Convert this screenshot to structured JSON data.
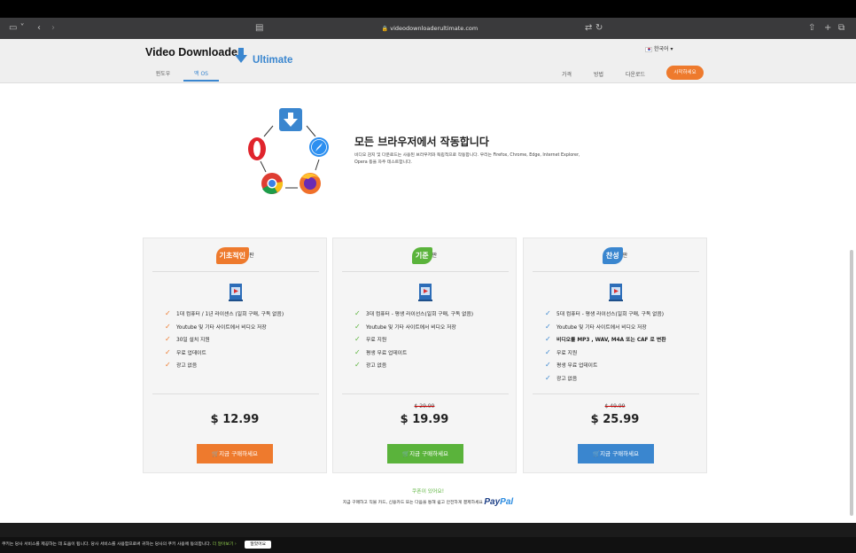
{
  "browser": {
    "url": "videodownloaderultimate.com"
  },
  "header": {
    "logo_main": "Video Downloader",
    "logo_sub": "Ultimate",
    "language": "한국어 ▾",
    "tabs": [
      {
        "label": "윈도우",
        "active": false
      },
      {
        "label": "맥 OS",
        "active": true
      }
    ],
    "nav": [
      "가격",
      "방법",
      "다운로드"
    ],
    "start_label": "시작하세요"
  },
  "feature": {
    "title": "모든 브라우저에서 작동합니다",
    "description": "비디오 감지 및 다운로드는 사용된 브라우저와 독립적으로 작동합니다. 우리는 Firefox, Chrome, Edge, Internet Explorer, Opera 등을 자주 테스트합니다."
  },
  "plans": [
    {
      "badge": "기초적인",
      "suffix": "판",
      "color": "#ee7a2d",
      "check_color": "#ee7a2d",
      "features": [
        "1대 컴퓨터 / 1년 라이센스 (일회 구매, 구독 없음)",
        "Youtube 및 기타 사이트에서 비디오 저장",
        "30일 설치 지원",
        "무료 업데이트",
        "광고 없음"
      ],
      "old_price": "",
      "price": "$ 12.99",
      "buy_label": "🛒지금 구매하세요"
    },
    {
      "badge": "기준",
      "suffix": "판",
      "color": "#5ab33b",
      "check_color": "#5ab33b",
      "features": [
        "3대 컴퓨터 - 평생 라이선스(일회 구매, 구독 없음)",
        "Youtube 및 기타 사이트에서 비디오 저장",
        "무료 지원",
        "평생 무료 업데이트",
        "광고 없음"
      ],
      "old_price": "$ 29.99",
      "price": "$ 19.99",
      "buy_label": "🛒지금 구매하세요"
    },
    {
      "badge": "찬성",
      "suffix": "판",
      "color": "#3a86cf",
      "check_color": "#3a86cf",
      "features": [
        "5대 컴퓨터 - 평생 라이선스(일회 구매, 구독 없음)",
        "Youtube 및 기타 사이트에서 비디오 저장",
        "비디오를 MP3 , WAV, M4A 또는 CAF 로 변환",
        "무료 지원",
        "평생 무료 업데이트",
        "광고 없음"
      ],
      "old_price": "$ 49.99",
      "price": "$ 25.99",
      "buy_label": "🛒지금 구매하세요"
    }
  ],
  "coupon": "쿠폰이 있어요!",
  "payment_info": "지금 구매하고 직불 카드, 신용카드 또는 다음을 통해 쉽고 안전하게 결제하세요",
  "paypal": {
    "pay": "Pay",
    "pal": "Pal"
  },
  "cookie": {
    "text": "쿠키는 당사 서비스를 제공하는 데 도움이 됩니다. 당사 서비스를 사용함으로써 귀하는 당사의 쿠키 사용에 동의합니다.",
    "more": "더 알아보기 ›",
    "ok": "알았어요"
  }
}
